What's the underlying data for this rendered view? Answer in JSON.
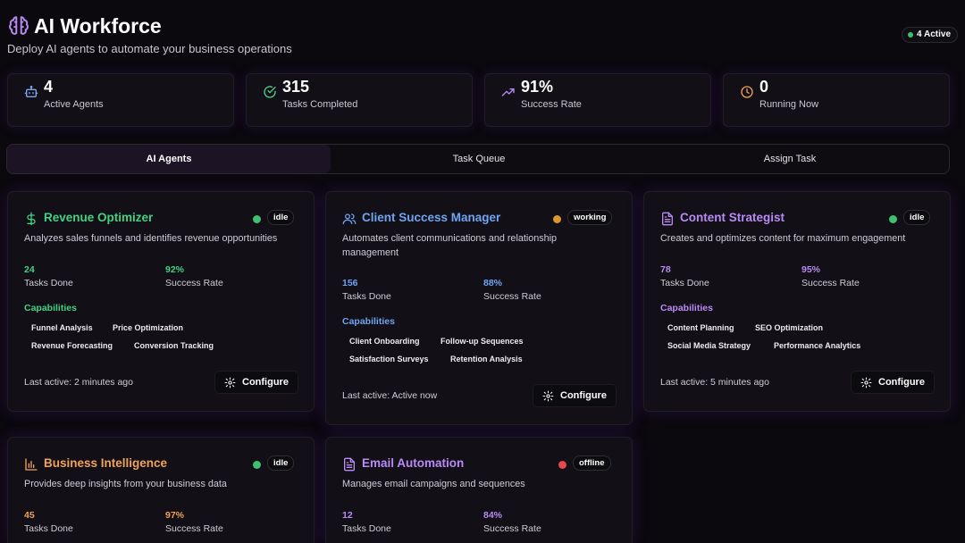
{
  "app": {
    "title": "AI Workforce",
    "subtitle": "Deploy AI agents to automate your business operations",
    "active_badge": "4 Active",
    "accent": "#b98af5",
    "icon": "brain-icon"
  },
  "stats": [
    {
      "value": "4",
      "label": "Active Agents",
      "icon": "robot-icon",
      "color": "#7ca8ef"
    },
    {
      "value": "315",
      "label": "Tasks Completed",
      "icon": "check-circle-icon",
      "color": "#4fd08a"
    },
    {
      "value": "91%",
      "label": "Success Rate",
      "icon": "trending-up-icon",
      "color": "#b98af5"
    },
    {
      "value": "0",
      "label": "Running Now",
      "icon": "clock-icon",
      "color": "#f0a25a"
    }
  ],
  "tabs": [
    {
      "label": "AI Agents",
      "active": true
    },
    {
      "label": "Task Queue",
      "active": false
    },
    {
      "label": "Assign Task",
      "active": false
    }
  ],
  "agents": [
    {
      "title": "Revenue Optimizer",
      "icon": "dollar-icon",
      "color": "#43d183",
      "status": "idle",
      "status_color": "#3ec070",
      "description": "Analyzes sales funnels and identifies revenue opportunities",
      "tasks_done": "24",
      "tasks_done_label": "Tasks Done",
      "success_rate": "92%",
      "success_rate_label": "Success Rate",
      "capabilities_title": "Capabilities",
      "capabilities": [
        "Funnel Analysis",
        "Price Optimization",
        "Revenue Forecasting",
        "Conversion Tracking"
      ],
      "last_active": "Last active: 2 minutes ago",
      "configure_label": "Configure"
    },
    {
      "title": "Client Success Manager",
      "icon": "users-icon",
      "color": "#6fa4f2",
      "status": "working",
      "status_color": "#d7982c",
      "description": "Automates client communications and relationship management",
      "tasks_done": "156",
      "tasks_done_label": "Tasks Done",
      "success_rate": "88%",
      "success_rate_label": "Success Rate",
      "capabilities_title": "Capabilities",
      "capabilities": [
        "Client Onboarding",
        "Follow-up Sequences",
        "Satisfaction Surveys",
        "Retention Analysis"
      ],
      "last_active": "Last active: Active now",
      "configure_label": "Configure"
    },
    {
      "title": "Content Strategist",
      "icon": "document-icon",
      "color": "#b98af5",
      "status": "idle",
      "status_color": "#3ec070",
      "description": "Creates and optimizes content for maximum engagement",
      "tasks_done": "78",
      "tasks_done_label": "Tasks Done",
      "success_rate": "95%",
      "success_rate_label": "Success Rate",
      "capabilities_title": "Capabilities",
      "capabilities": [
        "Content Planning",
        "SEO Optimization",
        "Social Media Strategy",
        "Performance Analytics"
      ],
      "last_active": "Last active: 5 minutes ago",
      "configure_label": "Configure"
    },
    {
      "title": "Business Intelligence",
      "icon": "bar-chart-icon",
      "color": "#f0a25a",
      "status": "idle",
      "status_color": "#3ec070",
      "description": "Provides deep insights from your business data",
      "tasks_done": "45",
      "tasks_done_label": "Tasks Done",
      "success_rate": "97%",
      "success_rate_label": "Success Rate"
    },
    {
      "title": "Email Automation",
      "icon": "document-icon",
      "color": "#b98af5",
      "status": "offline",
      "status_color": "#e5484d",
      "description": "Manages email campaigns and sequences",
      "tasks_done": "12",
      "tasks_done_label": "Tasks Done",
      "success_rate": "84%",
      "success_rate_label": "Success Rate"
    }
  ]
}
